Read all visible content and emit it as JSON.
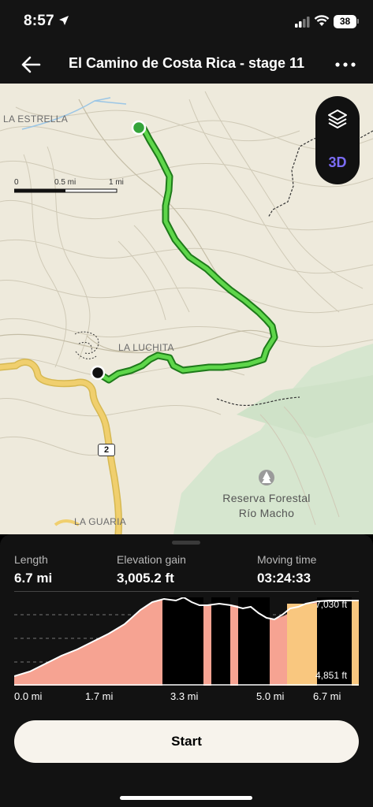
{
  "status": {
    "time": "8:57",
    "battery": "38"
  },
  "header": {
    "title": "El Camino de Costa Rica - stage  11",
    "back_icon": "arrow-left-icon",
    "more_icon": "more-dots-icon"
  },
  "map": {
    "scale": {
      "zero": "0",
      "half": "0.5 mi",
      "one": "1 mi"
    },
    "labels": {
      "la_estrella": "LA ESTRELLA",
      "la_luchita": "LA LUCHITA",
      "la_guaria": "LA GUARIA",
      "reserve_line1": "Reserva Forestal",
      "reserve_line2": "Río Macho"
    },
    "road_shield": "2",
    "controls": {
      "layers_icon": "layers-icon",
      "three_d": "3D"
    },
    "colors": {
      "route": "#4cc437",
      "route_outline": "#1e7a1a",
      "forest": "#d6e6cf",
      "road": "#f0cf6e"
    }
  },
  "stats": {
    "length": {
      "label": "Length",
      "value": "6.7 mi"
    },
    "elevation_gain": {
      "label": "Elevation gain",
      "value": "3,005.2 ft"
    },
    "moving_time": {
      "label": "Moving time",
      "value": "03:24:33"
    }
  },
  "elevation_chart": {
    "max_label": "7,030 ft",
    "min_label": "4,851 ft",
    "x_ticks": [
      "0.0 mi",
      "1.7 mi",
      "3.3 mi",
      "5.0 mi",
      "6.7 mi"
    ],
    "colors": {
      "climb": "#f6a392",
      "flat": "#000000",
      "steep": "#f9c77f"
    }
  },
  "start_button": {
    "label": "Start"
  }
}
